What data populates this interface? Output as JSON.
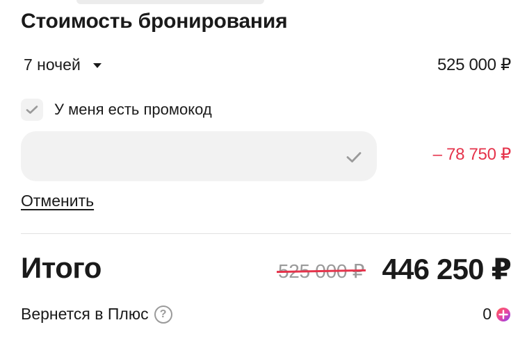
{
  "booking": {
    "title": "Стоимость бронирования",
    "nights_label": "7 ночей",
    "nights_price": "525 000 ₽",
    "promo_checkbox_label": "У меня есть промокод",
    "promo_checked": true,
    "promo_input_value": "",
    "promo_discount": "– 78 750 ₽",
    "cancel_label": "Отменить",
    "total_label": "Итого",
    "total_old_price": "525 000 ₽",
    "total_new_price": "446 250 ₽",
    "plus_label": "Вернется в Плюс",
    "plus_help_icon": "?",
    "plus_value": "0"
  },
  "colors": {
    "accent_red": "#e5334b",
    "text": "#1a1a1a",
    "muted": "#9a9a9a",
    "field_bg": "#f2f2f2"
  },
  "icons": [
    "chevron-down-icon",
    "check-icon",
    "help-icon",
    "plus-points-icon"
  ]
}
